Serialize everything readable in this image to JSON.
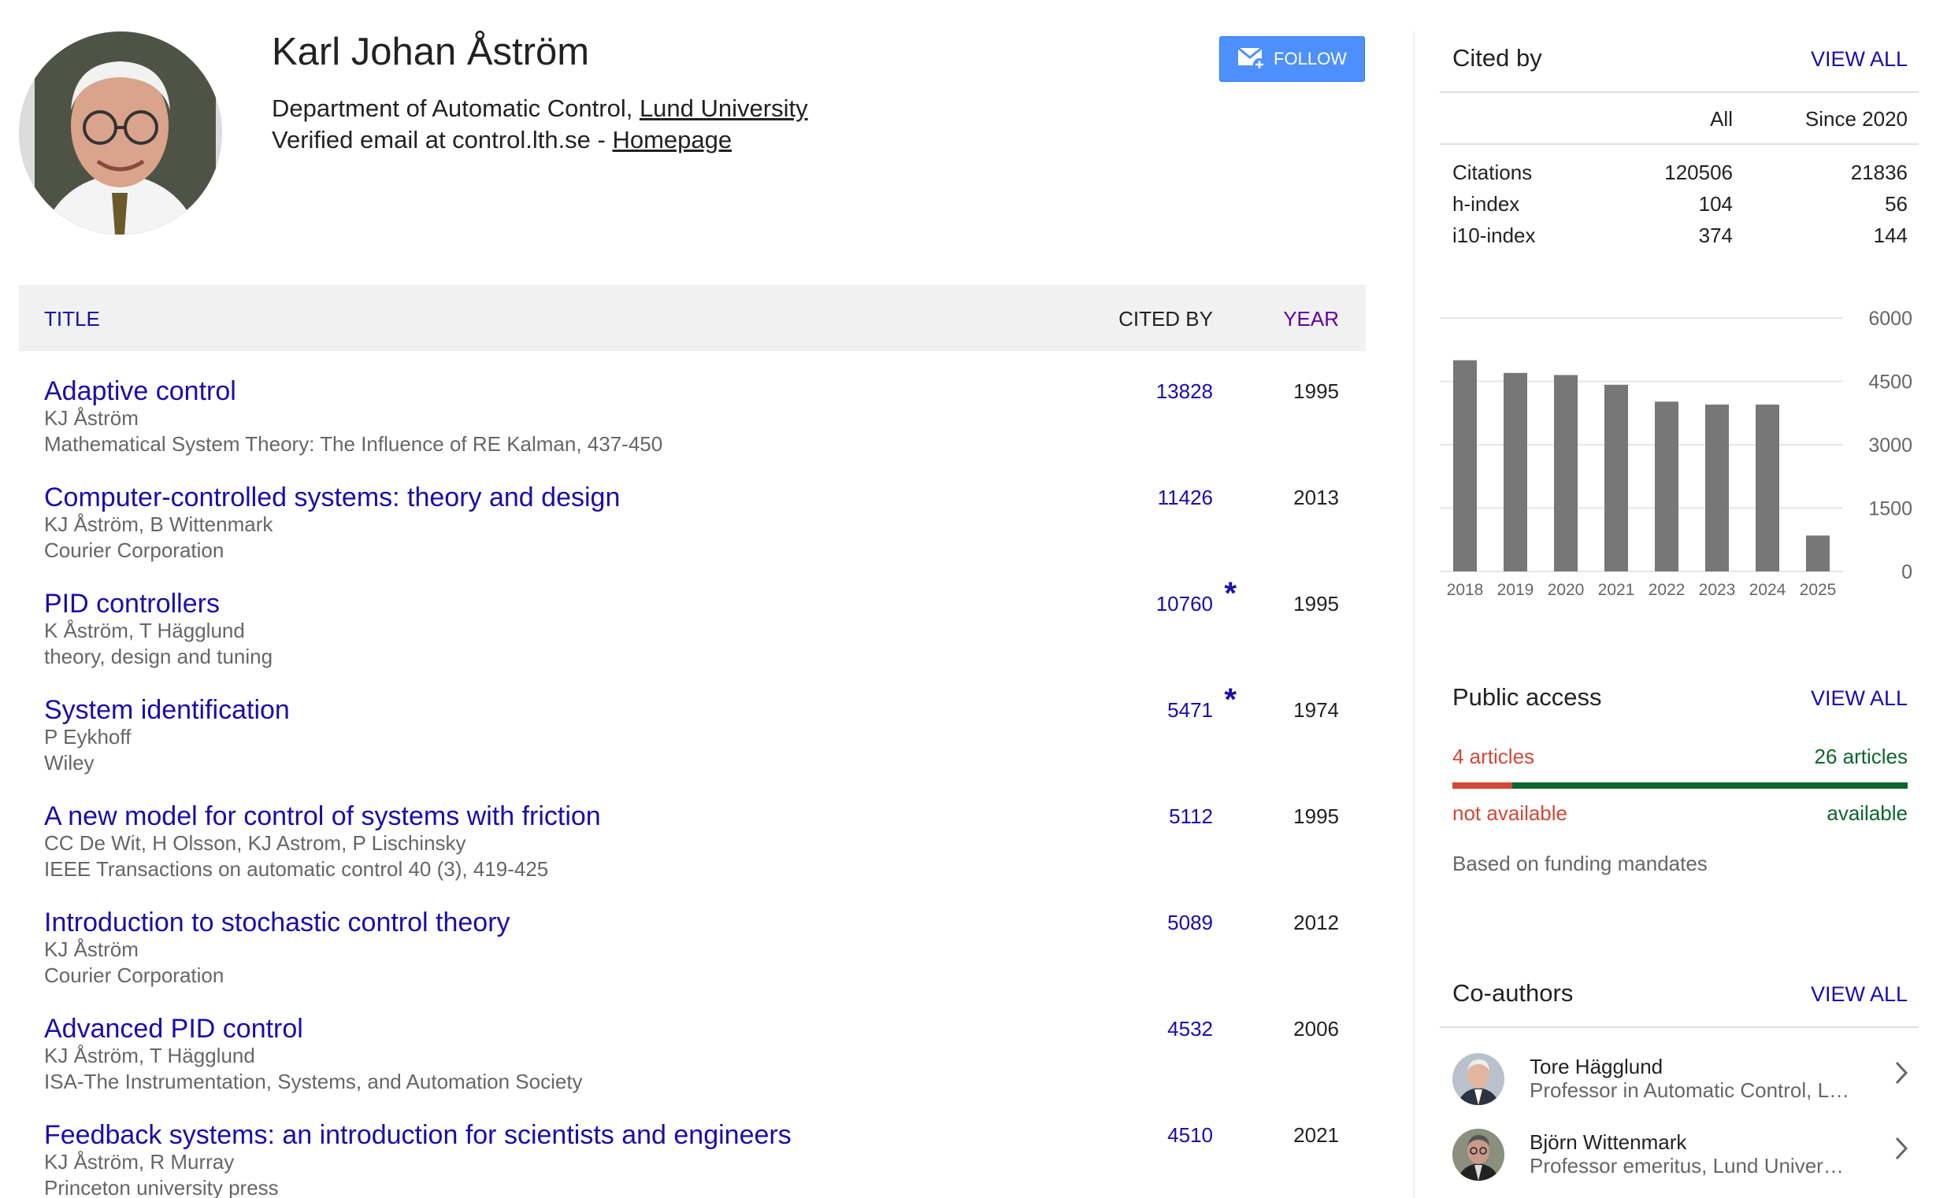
{
  "profile": {
    "name": "Karl Johan Åström",
    "department_prefix": "Department of Automatic Control, ",
    "university": "Lund University",
    "email_prefix": "Verified email at control.lth.se - ",
    "homepage": "Homepage",
    "follow_label": "FOLLOW"
  },
  "table": {
    "headers": {
      "title": "TITLE",
      "cited_by": "CITED BY",
      "year": "YEAR"
    },
    "rows": [
      {
        "title": "Adaptive control",
        "authors": "KJ Åström",
        "venue": "Mathematical System Theory: The Influence of RE Kalman, 437-450",
        "cited": "13828",
        "star": "",
        "year": "1995"
      },
      {
        "title": "Computer-controlled systems: theory and design",
        "authors": "KJ Åström, B Wittenmark",
        "venue": "Courier Corporation",
        "cited": "11426",
        "star": "",
        "year": "2013"
      },
      {
        "title": "PID controllers",
        "authors": "K Åström, T Hägglund",
        "venue": "theory, design and tuning",
        "cited": "10760",
        "star": "*",
        "year": "1995"
      },
      {
        "title": "System identification",
        "authors": "P Eykhoff",
        "venue": "Wiley",
        "cited": "5471",
        "star": "*",
        "year": "1974"
      },
      {
        "title": "A new model for control of systems with friction",
        "authors": "CC De Wit, H Olsson, KJ Astrom, P Lischinsky",
        "venue": "IEEE Transactions on automatic control 40 (3), 419-425",
        "cited": "5112",
        "star": "",
        "year": "1995"
      },
      {
        "title": "Introduction to stochastic control theory",
        "authors": "KJ Åström",
        "venue": "Courier Corporation",
        "cited": "5089",
        "star": "",
        "year": "2012"
      },
      {
        "title": "Advanced PID control",
        "authors": "KJ Åström, T Hägglund",
        "venue": "ISA-The Instrumentation, Systems, and Automation Society",
        "cited": "4532",
        "star": "",
        "year": "2006"
      },
      {
        "title": "Feedback systems: an introduction for scientists and engineers",
        "authors": "KJ Åström, R Murray",
        "venue": "Princeton university press",
        "cited": "4510",
        "star": "",
        "year": "2021"
      }
    ]
  },
  "cited_by": {
    "title": "Cited by",
    "view_all": "VIEW ALL",
    "col_all": "All",
    "col_since": "Since 2020",
    "rows": [
      {
        "label": "Citations",
        "all": "120506",
        "since": "21836"
      },
      {
        "label": "h-index",
        "all": "104",
        "since": "56"
      },
      {
        "label": "i10-index",
        "all": "374",
        "since": "144"
      }
    ]
  },
  "chart_data": {
    "type": "bar",
    "categories": [
      "2018",
      "2019",
      "2020",
      "2021",
      "2022",
      "2023",
      "2024",
      "2025"
    ],
    "values": [
      5000,
      4700,
      4650,
      4420,
      4020,
      3950,
      3950,
      850
    ],
    "ylim": [
      0,
      6000
    ],
    "yticks": [
      "6000",
      "4500",
      "3000",
      "1500",
      "0"
    ],
    "bar_color": "#777777",
    "grid": true,
    "title": "",
    "xlabel": "",
    "ylabel": ""
  },
  "public_access": {
    "title": "Public access",
    "view_all": "VIEW ALL",
    "not_available_count": "4 articles",
    "available_count": "26 articles",
    "not_available_label": "not available",
    "available_label": "available",
    "note": "Based on funding mandates",
    "not_available_color": "#d14836",
    "available_color": "#0d652d"
  },
  "coauthors": {
    "title": "Co-authors",
    "view_all": "VIEW ALL",
    "items": [
      {
        "name": "Tore Hägglund",
        "affiliation": "Professor in Automatic Control, L…"
      },
      {
        "name": "Björn Wittenmark",
        "affiliation": "Professor emeritus, Lund Univer…"
      }
    ]
  }
}
